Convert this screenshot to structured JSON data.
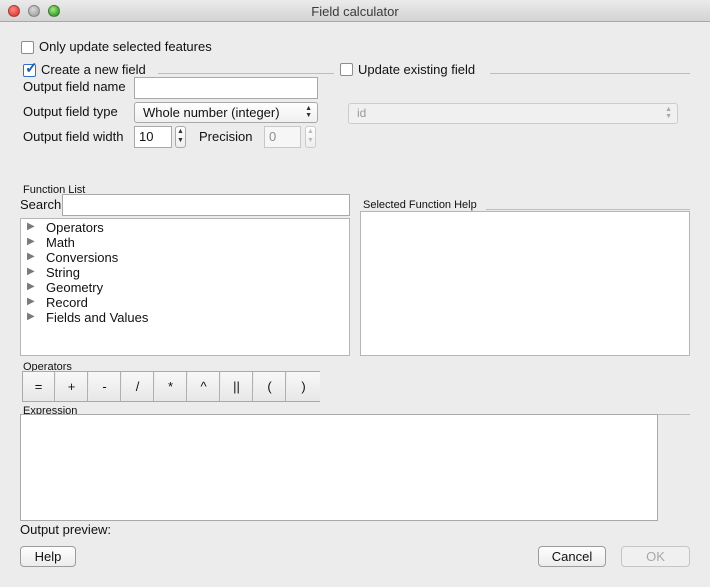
{
  "window": {
    "title": "Field calculator"
  },
  "options": {
    "only_selected_label": "Only update selected features",
    "only_selected_checked": false,
    "create_new_label": "Create a new field",
    "create_new_checked": true,
    "update_existing_label": "Update existing field",
    "update_existing_checked": false
  },
  "new_field": {
    "name_label": "Output field name",
    "name_value": "",
    "type_label": "Output field type",
    "type_value": "Whole number (integer)",
    "width_label": "Output field width",
    "width_value": "10",
    "precision_label": "Precision",
    "precision_value": "0"
  },
  "existing_field": {
    "selected": "id"
  },
  "function_list": {
    "title": "Function List",
    "search_label": "Search",
    "search_value": "",
    "items": [
      {
        "label": "Operators"
      },
      {
        "label": "Math"
      },
      {
        "label": "Conversions"
      },
      {
        "label": "String"
      },
      {
        "label": "Geometry"
      },
      {
        "label": "Record"
      },
      {
        "label": "Fields and Values"
      }
    ]
  },
  "help_panel": {
    "title": "Selected Function Help"
  },
  "operators": {
    "title": "Operators",
    "buttons": [
      "=",
      "+",
      "-",
      "/",
      "*",
      "^",
      "||",
      "(",
      ")"
    ]
  },
  "expression": {
    "title": "Expression",
    "value": ""
  },
  "footer": {
    "preview_label": "Output preview:",
    "help_button": "Help",
    "cancel_button": "Cancel",
    "ok_button": "OK"
  }
}
